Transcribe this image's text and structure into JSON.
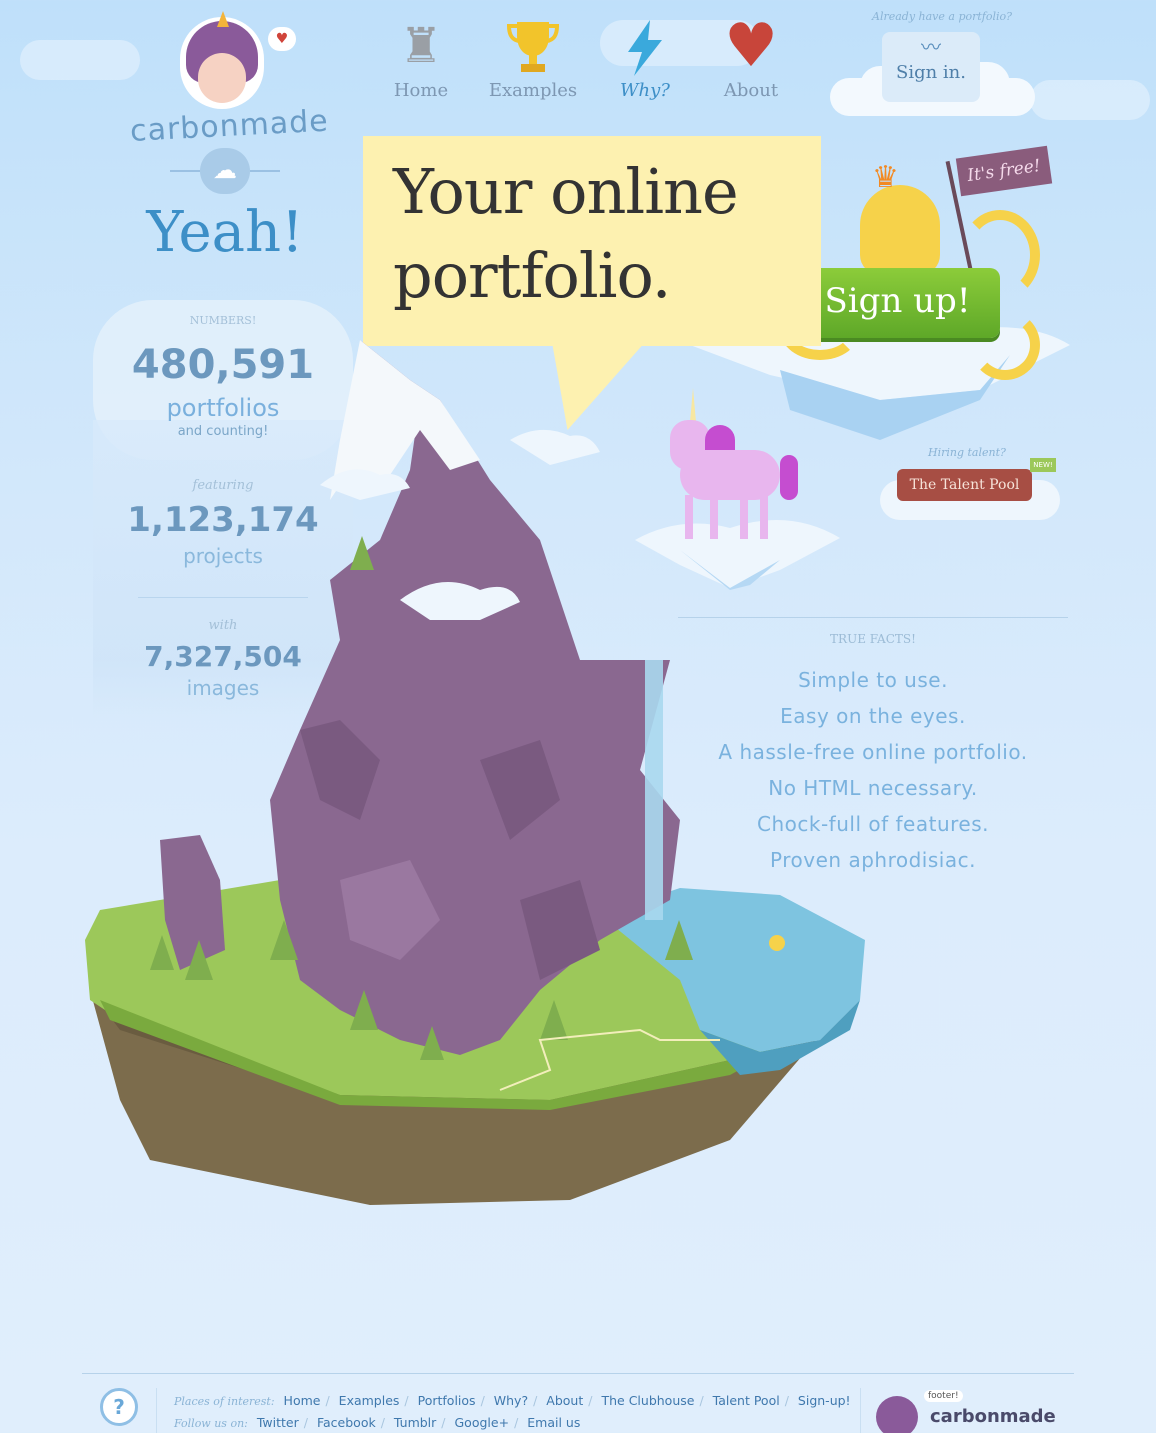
{
  "logo": {
    "wordmark": "carbonmade",
    "heart_icon": "heart-icon"
  },
  "tagline": "Yeah!",
  "nav": [
    {
      "label": "Home",
      "icon": "tower-icon",
      "glyph": "♜",
      "color": "#9a9fa5",
      "active": false
    },
    {
      "label": "Examples",
      "icon": "trophy-icon",
      "glyph": "🏆",
      "color": "#f2c42b",
      "active": false
    },
    {
      "label": "Why?",
      "icon": "lightning-icon",
      "glyph": "⚡",
      "color": "#3aa9dc",
      "active": true
    },
    {
      "label": "About",
      "icon": "heart-icon",
      "glyph": "♥",
      "color": "#c8453a",
      "active": false
    }
  ],
  "signin": {
    "prompt": "Already have a portfolio?",
    "label": "Sign in.",
    "icon": "mustache-icon"
  },
  "headline": {
    "line1": "Your online",
    "line2": "portfolio."
  },
  "signup": {
    "label": "Sign up!",
    "flag": "It's free!"
  },
  "talent": {
    "prompt": "Hiring talent?",
    "label": "The Talent Pool",
    "badge": "NEW!"
  },
  "stats": {
    "header": "NUMBERS!",
    "portfolios": {
      "value": "480,591",
      "unit": "portfolios",
      "sub": "and counting!"
    },
    "projects": {
      "lead": "featuring",
      "value": "1,123,174",
      "unit": "projects"
    },
    "images": {
      "lead": "with",
      "value": "7,327,504",
      "unit": "images"
    }
  },
  "facts": {
    "title": "TRUE FACTS!",
    "items": [
      "Simple to use.",
      "Easy on the eyes.",
      "A hassle-free online portfolio.",
      "No HTML necessary.",
      "Chock-full of features.",
      "Proven aphrodisiac."
    ]
  },
  "footer": {
    "places_label": "Places of interest:",
    "places": [
      "Home",
      "Examples",
      "Portfolios",
      "Why?",
      "About",
      "The Clubhouse",
      "Talent Pool",
      "Sign-up!"
    ],
    "follow_label": "Follow us on:",
    "follow": [
      "Twitter",
      "Facebook",
      "Tumblr",
      "Google+",
      "Email us"
    ],
    "help_icon": "question-icon",
    "logo_tag": "footer!",
    "logo_word": "carbonmade"
  },
  "colors": {
    "accent": "#3d8fc7",
    "headline_bg": "#fdf1b0",
    "signup_green": "#6cb52e",
    "talent_red": "#a74e44",
    "mountain": "#8a6890",
    "grass": "#9cc85a"
  }
}
